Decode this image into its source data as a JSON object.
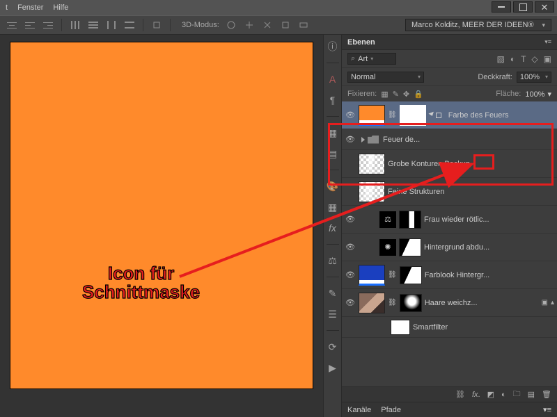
{
  "menu": {
    "window": "Fenster",
    "help": "Hilfe"
  },
  "toolbar": {
    "mode3d": "3D-Modus:",
    "credit": "Marco Kolditz, MEER DER IDEEN®"
  },
  "panel": {
    "tab": "Ebenen",
    "kind": "Art",
    "blend": "Normal",
    "opacity_label": "Deckkraft:",
    "opacity_value": "100%",
    "lock_label": "Fixieren:",
    "fill_label": "Fläche:",
    "fill_value": "100%",
    "channels": "Kanäle",
    "paths": "Pfade",
    "smartfilter": "Smartfilter"
  },
  "layers": [
    {
      "name": "Farbe des Feuers"
    },
    {
      "name": "Feuer de..."
    },
    {
      "name": "Grobe Konturen Backup"
    },
    {
      "name": "Feine Strukturen"
    },
    {
      "name": "Frau wieder rötlic..."
    },
    {
      "name": "Hintergrund abdu..."
    },
    {
      "name": "Farblook Hintergr..."
    },
    {
      "name": "Haare weichz..."
    }
  ],
  "annotation": {
    "line1": "Icon für",
    "line2": "Schnittmaske"
  }
}
